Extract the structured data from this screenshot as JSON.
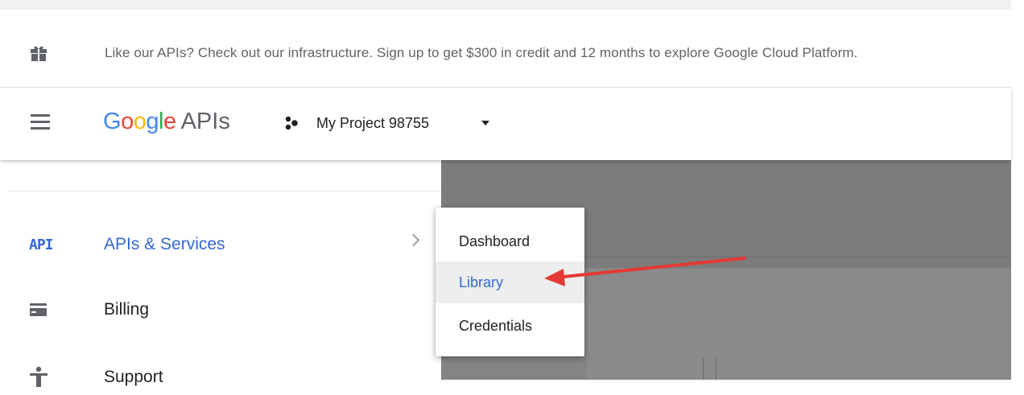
{
  "promo": {
    "icon": "gift-icon",
    "text": "Like our APIs? Check out our infrastructure. Sign up to get $300 in credit and 12 months to explore Google Cloud Platform."
  },
  "header": {
    "menu_icon": "hamburger-menu-icon",
    "logo": {
      "g1": "G",
      "o1": "o",
      "o2": "o",
      "g2": "g",
      "l": "l",
      "e": "e",
      "suffix": "APIs"
    },
    "project": {
      "icon": "project-dots-icon",
      "name": "My Project 98755",
      "caret": "dropdown-caret-icon"
    }
  },
  "sidebar": {
    "items": [
      {
        "icon": "API",
        "label": "APIs & Services",
        "active": true,
        "has_submenu": true
      },
      {
        "icon": "billing-icon",
        "label": "Billing"
      },
      {
        "icon": "support-icon",
        "label": "Support"
      }
    ]
  },
  "flyout": {
    "items": [
      {
        "label": "Dashboard"
      },
      {
        "label": "Library",
        "selected": true
      },
      {
        "label": "Credentials"
      }
    ]
  },
  "colors": {
    "google_blue": "#4285f4",
    "google_red": "#ea4335",
    "google_yellow": "#fbbc05",
    "google_green": "#34a853",
    "active_blue": "#3367d6",
    "annotation_arrow": "#e53935"
  }
}
